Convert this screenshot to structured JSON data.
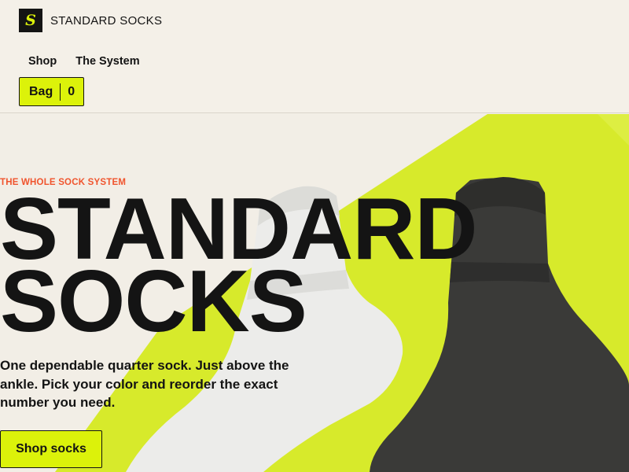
{
  "header": {
    "logo_letter": "S",
    "brand": "STANDARD SOCKS",
    "nav": [
      {
        "label": "Shop"
      },
      {
        "label": "The System"
      }
    ],
    "bag_label": "Bag",
    "bag_count": "0"
  },
  "hero": {
    "eyebrow": "THE WHOLE SOCK SYSTEM",
    "headline_line1": "STANDARD",
    "headline_line2": "SOCKS",
    "subtext": "One dependable quarter sock. Just above the ankle. Pick your color and reorder the exact number you need.",
    "cta_label": "Shop socks"
  },
  "colors": {
    "background": "#f4f0e8",
    "accent": "#dcf20a",
    "eyebrow": "#f0542d",
    "text": "#141414"
  },
  "icons": [
    "socks-image"
  ]
}
